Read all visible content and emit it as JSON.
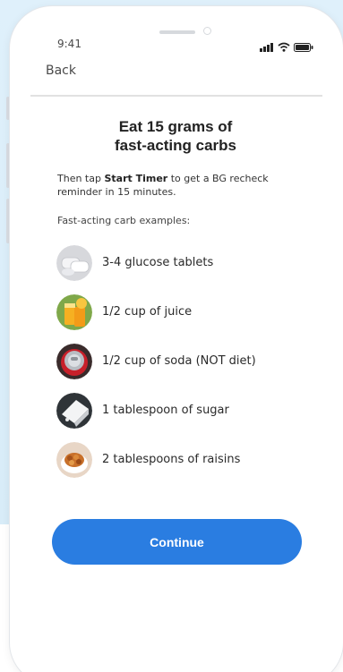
{
  "status_bar": {
    "time": "9:41",
    "icons": [
      "signal-icon",
      "wifi-icon",
      "battery-icon"
    ]
  },
  "nav": {
    "back_label": "Back"
  },
  "main": {
    "title_line1": "Eat 15 grams of",
    "title_line2": "fast-acting carbs",
    "intro_before": "Then tap ",
    "intro_bold": "Start Timer",
    "intro_after": " to get a BG recheck reminder in 15 minutes.",
    "examples_label": "Fast-acting carb examples:",
    "examples": [
      {
        "label": "3-4 glucose tablets",
        "icon": "glucose-tablets-image"
      },
      {
        "label": "1/2 cup of juice",
        "icon": "juice-image"
      },
      {
        "label": "1/2 cup of soda (NOT diet)",
        "icon": "soda-image"
      },
      {
        "label": "1 tablespoon of sugar",
        "icon": "sugar-image"
      },
      {
        "label": "2 tablespoons of raisins",
        "icon": "raisins-image"
      }
    ]
  },
  "footer": {
    "continue_label": "Continue"
  },
  "colors": {
    "accent": "#2a7de1",
    "background": "#dff0fb"
  }
}
